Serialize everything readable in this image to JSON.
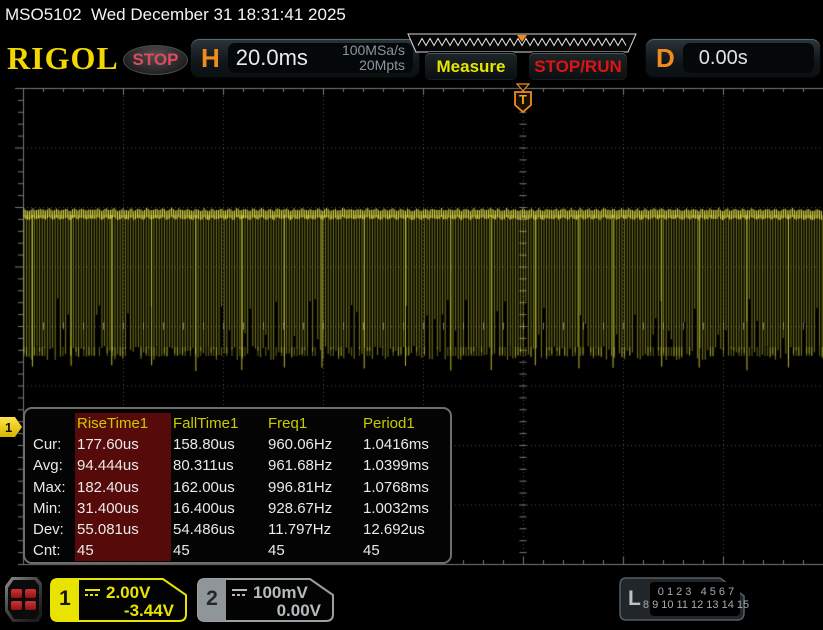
{
  "topbar": {
    "title": "MSO5102  Wed December 31 18:31:41 2025"
  },
  "header": {
    "logo": "RIGOL",
    "acquisition_status": "STOP",
    "horizontal": {
      "label": "H",
      "timebase": "20.0ms",
      "sample_rate": "100MSa/s",
      "memory_depth": "20Mpts"
    },
    "measure_button": "Measure",
    "stop_run_button": "STOP/RUN",
    "delay": {
      "label": "D",
      "value": "0.00s"
    }
  },
  "trigger": {
    "marker": "T"
  },
  "measurements": {
    "row_labels": [
      "Cur:",
      "Avg:",
      "Max:",
      "Min:",
      "Dev:",
      "Cnt:"
    ],
    "columns": [
      {
        "name": "RiseTime1",
        "values": [
          "177.60us",
          "94.444us",
          "182.40us",
          "31.400us",
          "55.081us",
          "45"
        ]
      },
      {
        "name": "FallTime1",
        "values": [
          "158.80us",
          "80.311us",
          "162.00us",
          "16.400us",
          "54.486us",
          "45"
        ]
      },
      {
        "name": "Freq1",
        "values": [
          "960.06Hz",
          "961.68Hz",
          "996.81Hz",
          "928.67Hz",
          "11.797Hz",
          "45"
        ]
      },
      {
        "name": "Period1",
        "values": [
          "1.0416ms",
          "1.0399ms",
          "1.0768ms",
          "1.0032ms",
          "12.692us",
          "45"
        ]
      }
    ]
  },
  "channels": {
    "ch1": {
      "number": "1",
      "scale": "2.00V",
      "offset": "-3.44V"
    },
    "ch2": {
      "number": "2",
      "scale": "100mV",
      "offset": "0.00V"
    },
    "logic": {
      "label": "L",
      "row1": "0 1 2 3   4 5 6 7",
      "row2": "8 9 10 11 12 13 14 15"
    }
  },
  "colors": {
    "ch1_yellow": "#e8e400",
    "ch2_gray": "#9aa0a2",
    "accent_orange": "#f08c1e",
    "waveform_body": "rgba(205,205,45,0.60)",
    "waveform_top": "rgba(248,244,82,0.95)",
    "grid_line": "rgba(255,255,255,0.30)",
    "grid_edge": "#787878",
    "stop_text": "#e0495f",
    "run_red": "#e01212",
    "measure_yellow": "#e6e600",
    "highlight_maroon": "#570a0a"
  }
}
